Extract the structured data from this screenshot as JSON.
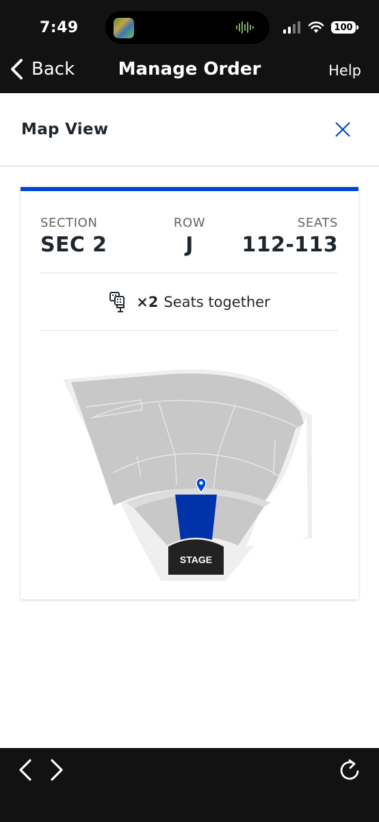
{
  "status_bar": {
    "time": "7:49",
    "battery": "100"
  },
  "nav": {
    "back_label": "Back",
    "title": "Manage Order",
    "help_label": "Help"
  },
  "map_view": {
    "title": "Map View"
  },
  "ticket": {
    "section_label": "SECTION",
    "section_value": "SEC 2",
    "row_label": "ROW",
    "row_value": "J",
    "seats_label": "SEATS",
    "seats_value": "112-113",
    "together_count": "×2",
    "together_text": "Seats together"
  },
  "seat_map": {
    "stage_label": "STAGE",
    "highlight_color": "#0033aa"
  },
  "colors": {
    "accent": "#0046d4",
    "bar_bg": "#121212"
  }
}
